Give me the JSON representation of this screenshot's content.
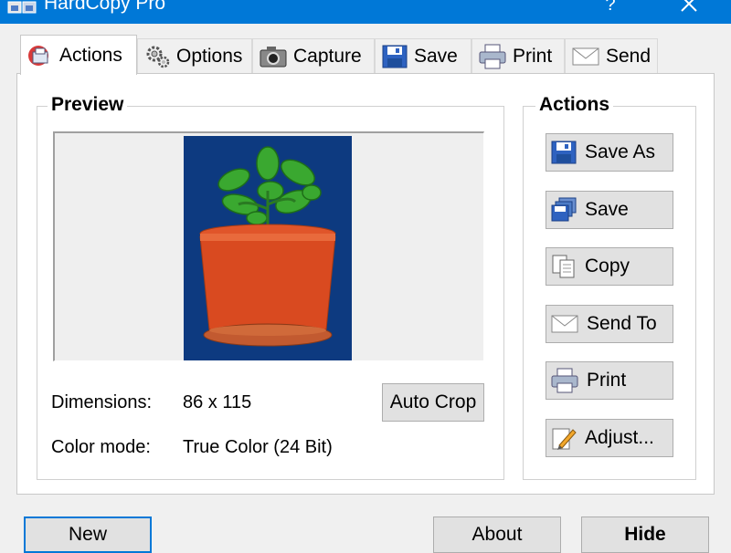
{
  "window": {
    "title": "HardCopy Pro",
    "help_label": "?"
  },
  "tabs": [
    {
      "label": "Actions",
      "icon": "actions-icon",
      "active": true
    },
    {
      "label": "Options",
      "icon": "gear-icon",
      "active": false
    },
    {
      "label": "Capture",
      "icon": "camera-icon",
      "active": false
    },
    {
      "label": "Save",
      "icon": "floppy-icon",
      "active": false
    },
    {
      "label": "Print",
      "icon": "printer-icon",
      "active": false
    },
    {
      "label": "Send",
      "icon": "envelope-icon",
      "active": false
    }
  ],
  "preview": {
    "title": "Preview",
    "dimensions_label": "Dimensions:",
    "dimensions_value": "86 x 115",
    "color_mode_label": "Color mode:",
    "color_mode_value": "True Color (24 Bit)",
    "auto_crop_label": "Auto Crop"
  },
  "actions": {
    "title": "Actions",
    "save_as": "Save As",
    "save": "Save",
    "copy": "Copy",
    "send_to": "Send To",
    "print": "Print",
    "adjust": "Adjust..."
  },
  "footer": {
    "new": "New",
    "about": "About",
    "hide": "Hide"
  },
  "colors": {
    "titlebar": "#0078d7",
    "preview_background": "#0d3a80",
    "pot": "#d94a20",
    "plant": "#3aa830"
  }
}
